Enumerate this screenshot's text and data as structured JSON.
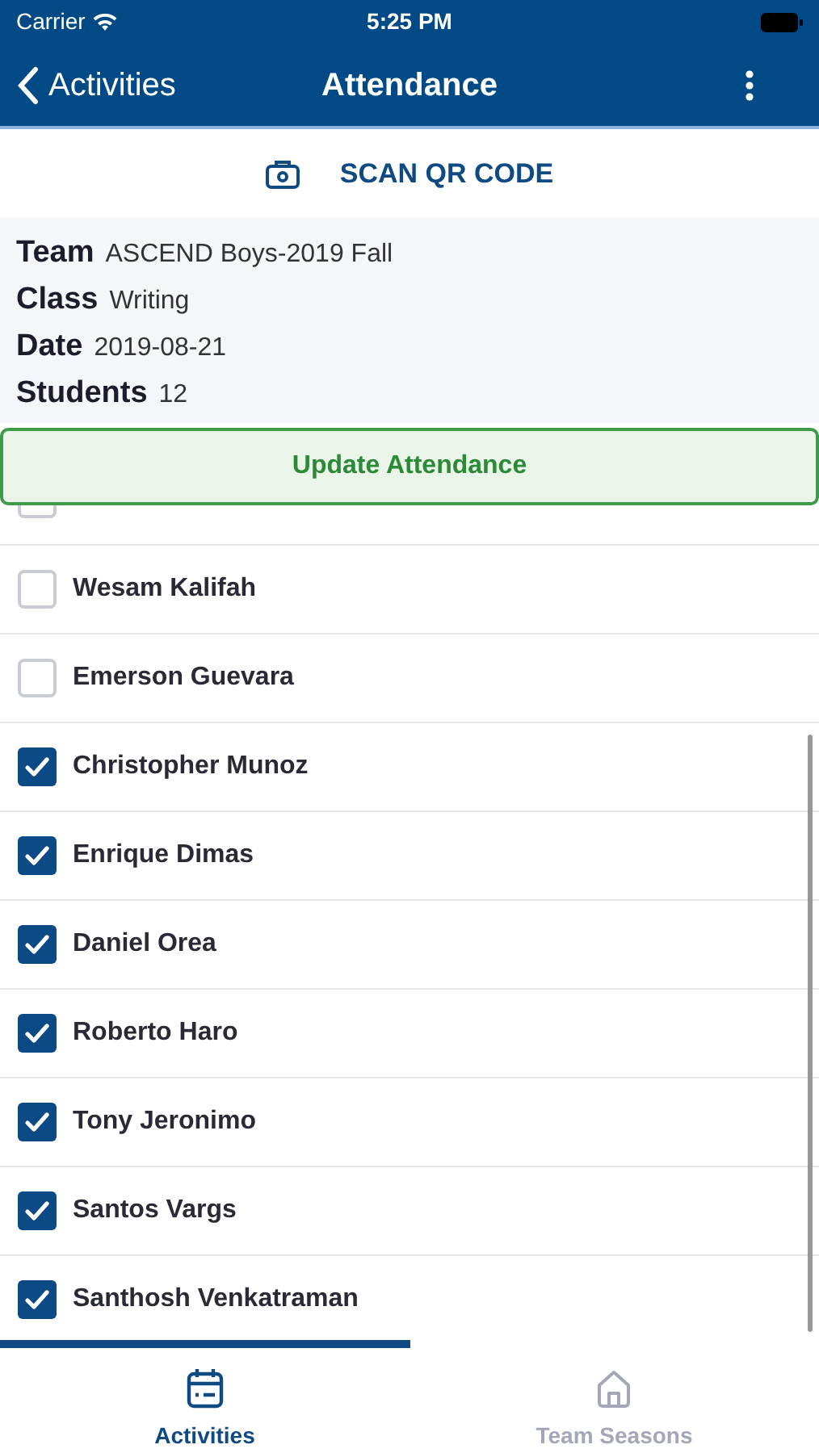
{
  "status_bar": {
    "carrier": "Carrier",
    "time": "5:25 PM"
  },
  "nav": {
    "back": "Activities",
    "title": "Attendance"
  },
  "scan_button": {
    "label": "SCAN QR CODE"
  },
  "info": [
    {
      "label": "Team",
      "value": "ASCEND Boys-2019 Fall"
    },
    {
      "label": "Class",
      "value": "Writing"
    },
    {
      "label": "Date",
      "value": "2019-08-21"
    },
    {
      "label": "Students",
      "value": "12"
    }
  ],
  "update_button": {
    "label": "Update Attendance"
  },
  "students": [
    {
      "checked": false
    },
    {
      "name": "Wesam Kalifah",
      "checked": false
    },
    {
      "name": "Emerson Guevara",
      "checked": false
    },
    {
      "name": "Christopher Munoz",
      "checked": true
    },
    {
      "name": "Enrique Dimas",
      "checked": true
    },
    {
      "name": "Daniel Orea",
      "checked": true
    },
    {
      "name": "Roberto Haro",
      "checked": true
    },
    {
      "name": "Tony Jeronimo",
      "checked": true
    },
    {
      "name": "Santos Vargs",
      "checked": true
    },
    {
      "name": "Santhosh Venkatraman",
      "checked": true
    }
  ],
  "tabs": [
    {
      "label": "Activities",
      "selected": true
    },
    {
      "label": "Team Seasons",
      "selected": false
    }
  ]
}
